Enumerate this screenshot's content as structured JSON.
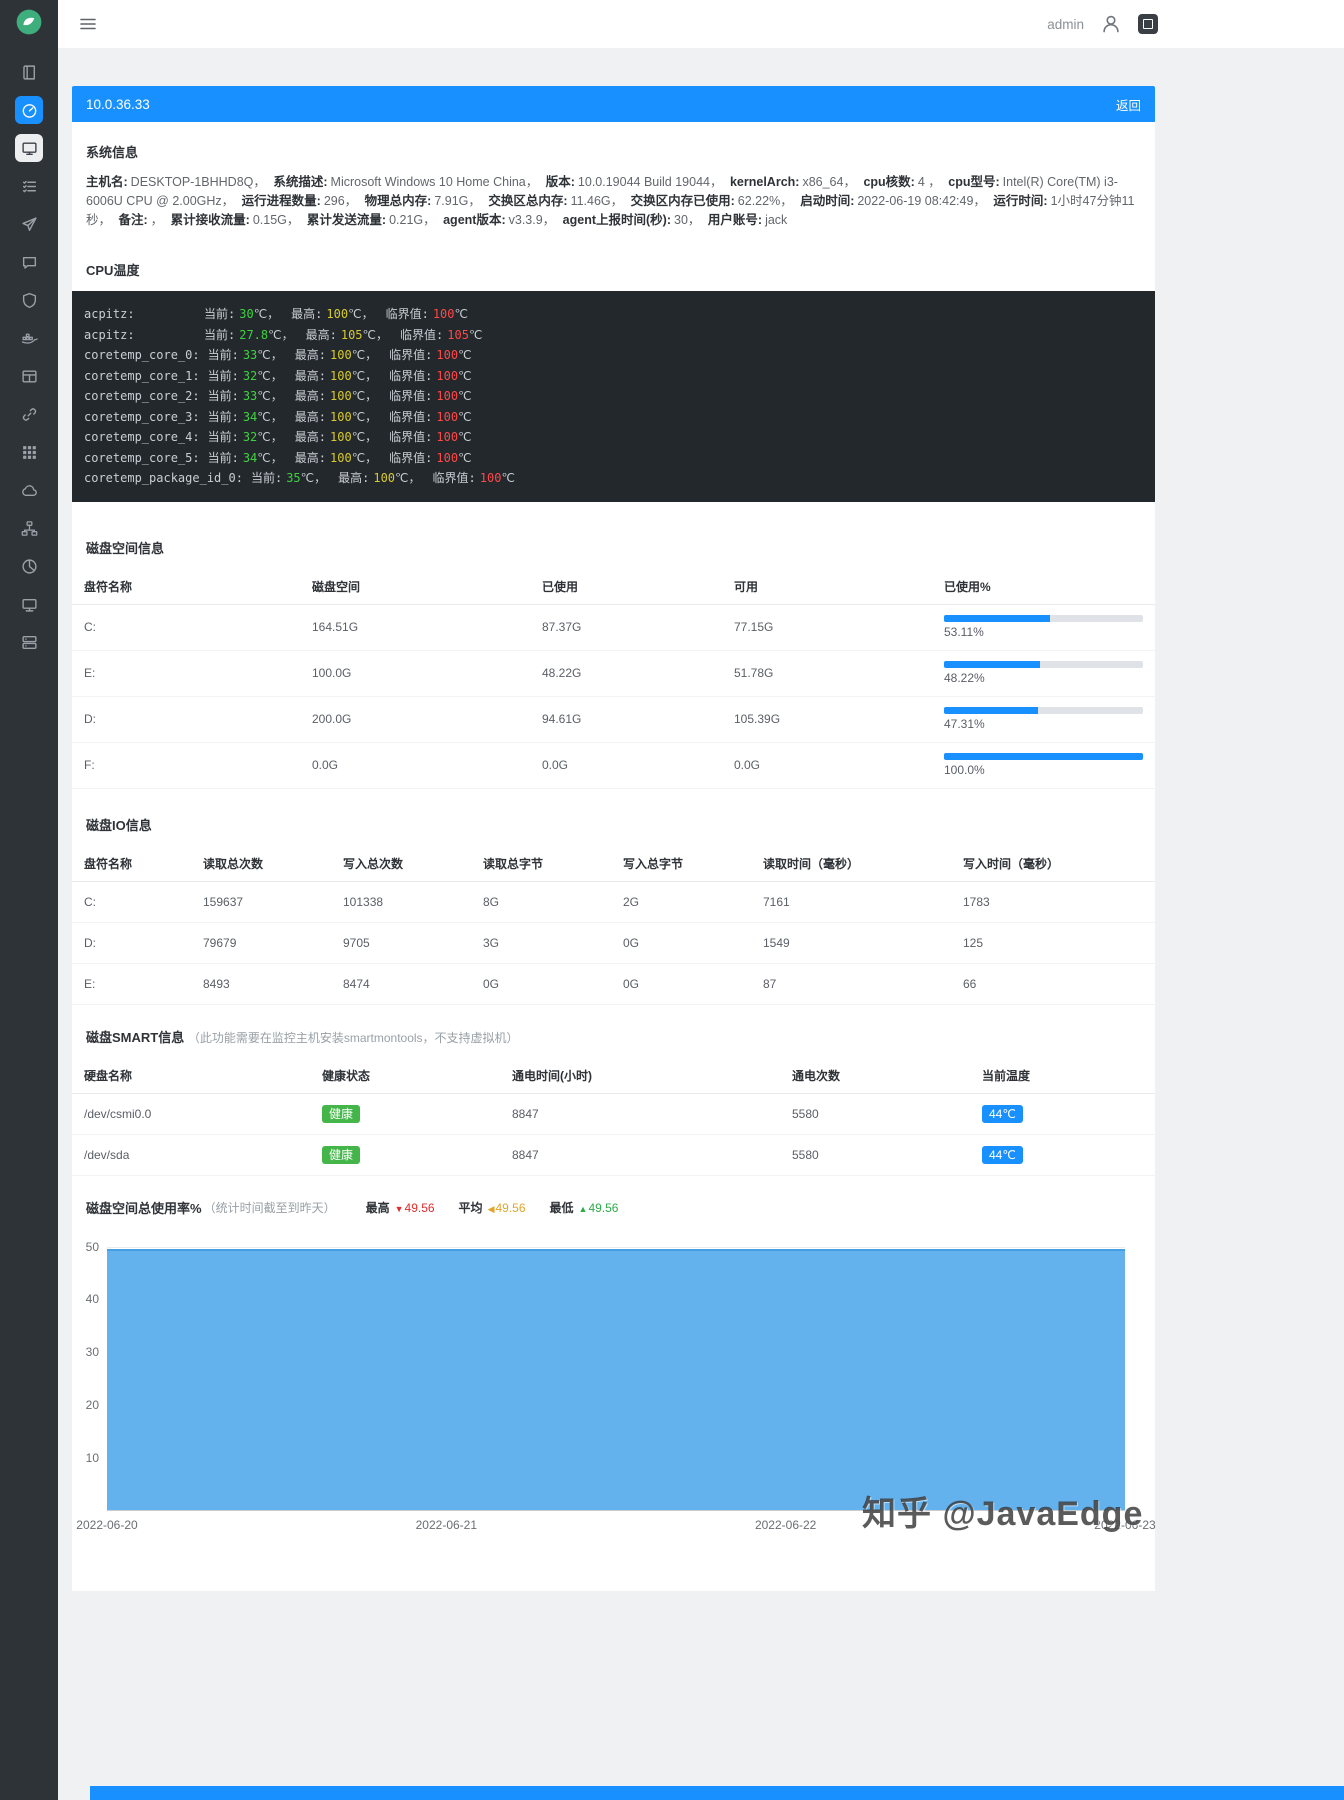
{
  "colors": {
    "primary": "#1890ff",
    "sidebar_bg": "#2e3338",
    "terminal_bg": "#23282d",
    "temp_current_green": "#3ed33e",
    "temp_max_yellow": "#d8ca2e",
    "temp_critical_red": "#ff4848",
    "health_badge_green": "#44b549",
    "temp_badge_blue": "#1890ff"
  },
  "topbar": {
    "username": "admin"
  },
  "sidebar": {
    "icons": [
      "app-logo",
      "book",
      "dashboard",
      "display",
      "checklist",
      "send",
      "chat",
      "shield",
      "docker",
      "table",
      "link",
      "apps-grid",
      "cloud",
      "topology",
      "pie-chart",
      "screen",
      "server-stack"
    ],
    "active_item": "dashboard",
    "current_item": "display"
  },
  "host": {
    "ip": "10.0.36.33",
    "back_label": "返回"
  },
  "system_info": {
    "title": "系统信息",
    "fields": [
      {
        "label": "主机名:",
        "value": "DESKTOP-1BHHD8Q，"
      },
      {
        "label": "系统描述:",
        "value": "Microsoft Windows 10 Home China，"
      },
      {
        "label": "版本:",
        "value": "10.0.19044 Build 19044，"
      },
      {
        "label": "kernelArch:",
        "value": "x86_64，"
      },
      {
        "label": "cpu核数:",
        "value": "4 ，"
      },
      {
        "label": "cpu型号:",
        "value": "Intel(R) Core(TM) i3-6006U CPU @ 2.00GHz，"
      },
      {
        "label": "运行进程数量:",
        "value": "296，"
      },
      {
        "label": "物理总内存:",
        "value": "7.91G，"
      },
      {
        "label": "交换区总内存:",
        "value": "11.46G，"
      },
      {
        "label": "交换区内存已使用:",
        "value": "62.22%，"
      },
      {
        "label": "启动时间:",
        "value": "2022-06-19 08:42:49，"
      },
      {
        "label": "运行时间:",
        "value": "1小时47分钟11秒，"
      },
      {
        "label": "备注:",
        "value": "，"
      },
      {
        "label": "累计接收流量:",
        "value": "0.15G，"
      },
      {
        "label": "累计发送流量:",
        "value": "0.21G，"
      },
      {
        "label": "agent版本:",
        "value": "v3.3.9，"
      },
      {
        "label": "agent上报时间(秒):",
        "value": "30，"
      },
      {
        "label": "用户账号:",
        "value": "jack"
      }
    ]
  },
  "cpu_temp": {
    "title": "CPU温度",
    "labels": {
      "cur": "当前:",
      "max": "最高:",
      "crit": "临界值:",
      "unit_sep": "℃，",
      "unit_end": "℃"
    },
    "lines": [
      {
        "name": "acpitz:",
        "cur": "30",
        "max": "100",
        "crit": "100"
      },
      {
        "name": "acpitz:",
        "cur": "27.8",
        "max": "105",
        "crit": "105"
      },
      {
        "name": "coretemp_core_0:",
        "cur": "33",
        "max": "100",
        "crit": "100"
      },
      {
        "name": "coretemp_core_1:",
        "cur": "32",
        "max": "100",
        "crit": "100"
      },
      {
        "name": "coretemp_core_2:",
        "cur": "33",
        "max": "100",
        "crit": "100"
      },
      {
        "name": "coretemp_core_3:",
        "cur": "34",
        "max": "100",
        "crit": "100"
      },
      {
        "name": "coretemp_core_4:",
        "cur": "32",
        "max": "100",
        "crit": "100"
      },
      {
        "name": "coretemp_core_5:",
        "cur": "34",
        "max": "100",
        "crit": "100"
      },
      {
        "name": "coretemp_package_id_0:",
        "cur": "35",
        "max": "100",
        "crit": "100"
      }
    ]
  },
  "disk_space": {
    "title": "磁盘空间信息",
    "headers": [
      "盘符名称",
      "磁盘空间",
      "已使用",
      "可用",
      "已使用%"
    ],
    "rows": [
      {
        "name": "C:",
        "total": "164.51G",
        "used": "87.37G",
        "free": "77.15G",
        "percent": "53.11%",
        "bar": "53.11%"
      },
      {
        "name": "E:",
        "total": "100.0G",
        "used": "48.22G",
        "free": "51.78G",
        "percent": "48.22%",
        "bar": "48.22%"
      },
      {
        "name": "D:",
        "total": "200.0G",
        "used": "94.61G",
        "free": "105.39G",
        "percent": "47.31%",
        "bar": "47.31%"
      },
      {
        "name": "F:",
        "total": "0.0G",
        "used": "0.0G",
        "free": "0.0G",
        "percent": "100.0%",
        "bar": "100%"
      }
    ]
  },
  "disk_io": {
    "title": "磁盘IO信息",
    "headers": [
      "盘符名称",
      "读取总次数",
      "写入总次数",
      "读取总字节",
      "写入总字节",
      "读取时间（毫秒）",
      "写入时间（毫秒）"
    ],
    "rows": [
      {
        "name": "C:",
        "reads": "159637",
        "writes": "101338",
        "read_bytes": "8G",
        "write_bytes": "2G",
        "read_time": "7161",
        "write_time": "1783"
      },
      {
        "name": "D:",
        "reads": "79679",
        "writes": "9705",
        "read_bytes": "3G",
        "write_bytes": "0G",
        "read_time": "1549",
        "write_time": "125"
      },
      {
        "name": "E:",
        "reads": "8493",
        "writes": "8474",
        "read_bytes": "0G",
        "write_bytes": "0G",
        "read_time": "87",
        "write_time": "66"
      }
    ]
  },
  "smart": {
    "title": "磁盘SMART信息",
    "note": "（此功能需要在监控主机安装smartmontools，不支持虚拟机）",
    "headers": [
      "硬盘名称",
      "健康状态",
      "通电时间(小时)",
      "通电次数",
      "当前温度"
    ],
    "rows": [
      {
        "name": "/dev/csmi0.0",
        "health": "健康",
        "hours": "8847",
        "count": "5580",
        "temp": "44℃"
      },
      {
        "name": "/dev/sda",
        "health": "健康",
        "hours": "8847",
        "count": "5580",
        "temp": "44℃"
      }
    ]
  },
  "chart_data": {
    "type": "area",
    "title": "磁盘空间总使用率%",
    "subtitle": "（统计时间截至到昨天）",
    "stats": [
      {
        "label": "最高",
        "marker": "▼",
        "value": "49.56",
        "color": "#e02b2b"
      },
      {
        "label": "平均",
        "marker": "◀",
        "value": "49.56",
        "color": "#e0a52c"
      },
      {
        "label": "最低",
        "marker": "▲",
        "value": "49.56",
        "color": "#2faa4a"
      }
    ],
    "x": [
      "2022-06-20",
      "2022-06-21",
      "2022-06-22",
      "2022-06-23"
    ],
    "values": [
      49.56,
      49.56,
      49.56,
      49.56
    ],
    "ylim": [
      0,
      50
    ],
    "yticks": [
      "50",
      "40",
      "30",
      "20",
      "10"
    ],
    "grid": true,
    "legend": "none",
    "fill_color": "#63b2ee",
    "line_color": "#459ee3"
  },
  "watermark": "知乎 @JavaEdge"
}
